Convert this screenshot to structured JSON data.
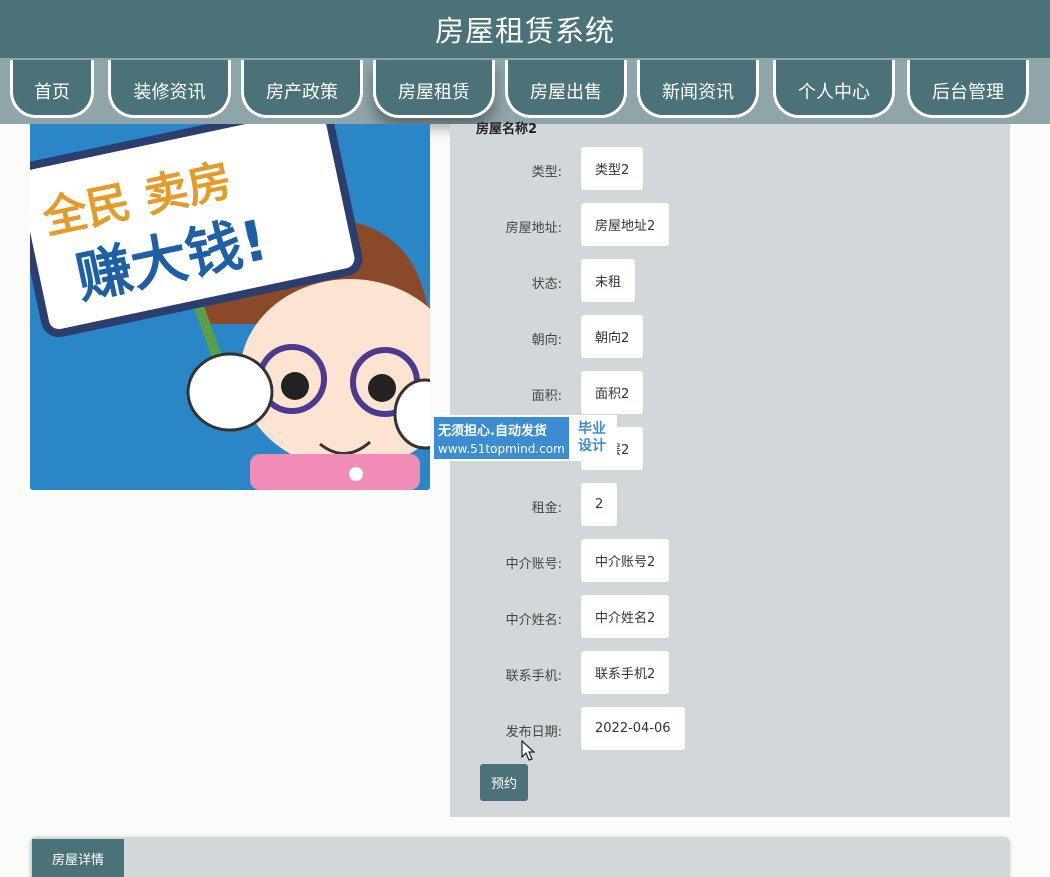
{
  "app_title": "房屋租赁系统",
  "nav": {
    "items": [
      {
        "label": "首页"
      },
      {
        "label": "装修资讯"
      },
      {
        "label": "房产政策"
      },
      {
        "label": "房屋租赁"
      },
      {
        "label": "房屋出售"
      },
      {
        "label": "新闻资讯"
      },
      {
        "label": "个人中心"
      },
      {
        "label": "后台管理"
      }
    ],
    "active_index": 3
  },
  "image": {
    "sign_line1": "全民 卖房",
    "sign_line2": "赚大钱!"
  },
  "detail": {
    "name_partial": "房屋名称2",
    "fields": [
      {
        "label": "类型:",
        "value": "类型2"
      },
      {
        "label": "房屋地址:",
        "value": "房屋地址2"
      },
      {
        "label": "状态:",
        "value": "未租"
      },
      {
        "label": "朝向:",
        "value": "朝向2"
      },
      {
        "label": "面积:",
        "value": "面积2"
      },
      {
        "label": "",
        "value": "楼层2"
      },
      {
        "label": "租金:",
        "value": "2"
      },
      {
        "label": "中介账号:",
        "value": "中介账号2"
      },
      {
        "label": "中介姓名:",
        "value": "中介姓名2"
      },
      {
        "label": "联系手机:",
        "value": "联系手机2"
      },
      {
        "label": "发布日期:",
        "value": "2022-04-06"
      }
    ],
    "reserve_label": "预约"
  },
  "watermark": {
    "line1": "无须担心.自动发货",
    "line2": "www.51topmind.com",
    "badge_line1": "毕业",
    "badge_line2": "设计"
  },
  "tabs": [
    {
      "label": "房屋详情"
    }
  ],
  "colors": {
    "primary": "#4a7278",
    "nav_bg": "#8fa5a9",
    "panel_bg": "#d2d8d9",
    "watermark_blue": "#3b8cd1"
  }
}
